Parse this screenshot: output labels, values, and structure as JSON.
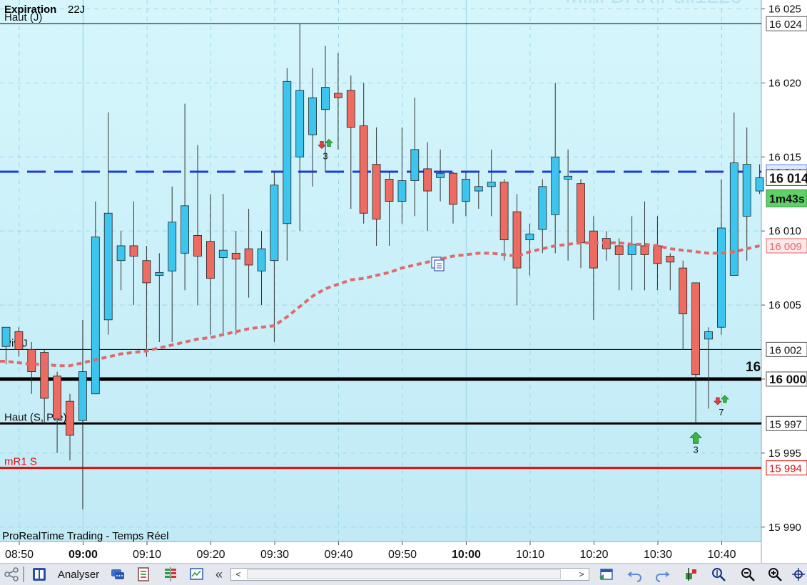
{
  "header": {
    "expiration_label": "Expiration",
    "expiration_value": "22J",
    "watermark": "Mini DAX Full1225",
    "branding": "ProRealTime Trading - Temps Réel"
  },
  "chart_data": {
    "type": "candlestick",
    "instrument": "Mini DAX Full1225",
    "ylim": [
      15989,
      16025.6
    ],
    "y_ticks": [
      {
        "value": 16025,
        "label": "16 025"
      },
      {
        "value": 16020,
        "label": "16 020"
      },
      {
        "value": 16015,
        "label": "16 015"
      },
      {
        "value": 16010,
        "label": "16 010"
      },
      {
        "value": 16005,
        "label": "16 005"
      },
      {
        "value": 16000,
        "label": "16 000"
      },
      {
        "value": 15995,
        "label": "15 995"
      },
      {
        "value": 15990,
        "label": "15 990"
      }
    ],
    "x_ticks": [
      {
        "label": "08:50",
        "major": false
      },
      {
        "label": "09:00",
        "major": true
      },
      {
        "label": "09:10",
        "major": false
      },
      {
        "label": "09:20",
        "major": false
      },
      {
        "label": "09:30",
        "major": false
      },
      {
        "label": "09:40",
        "major": false
      },
      {
        "label": "09:50",
        "major": false
      },
      {
        "label": "10:00",
        "major": true
      },
      {
        "label": "10:10",
        "major": false
      },
      {
        "label": "10:20",
        "major": false
      },
      {
        "label": "10:30",
        "major": false
      },
      {
        "label": "10:40",
        "major": false
      }
    ],
    "candles": [
      {
        "o": 16002.2,
        "h": 16003.0,
        "l": 16001.0,
        "c": 16003.5
      },
      {
        "o": 16003.2,
        "h": 16003.5,
        "l": 16001.5,
        "c": 16002.0
      },
      {
        "o": 16002.0,
        "h": 16002.5,
        "l": 15999.0,
        "c": 16000.5
      },
      {
        "o": 16001.8,
        "h": 16002.0,
        "l": 15997.0,
        "c": 15998.7
      },
      {
        "o": 16000.2,
        "h": 16000.5,
        "l": 15995.0,
        "c": 15997.3
      },
      {
        "o": 15998.5,
        "h": 15999.0,
        "l": 15994.5,
        "c": 15996.2
      },
      {
        "o": 15997.2,
        "h": 16004.0,
        "l": 15991.2,
        "c": 16000.5
      },
      {
        "o": 15999.0,
        "h": 16012.0,
        "l": 15999.0,
        "c": 16009.6
      },
      {
        "o": 16004.0,
        "h": 16018.0,
        "l": 16003.0,
        "c": 16011.2
      },
      {
        "o": 16008.0,
        "h": 16010.0,
        "l": 16006.0,
        "c": 16009.0
      },
      {
        "o": 16009.0,
        "h": 16012.0,
        "l": 16005.0,
        "c": 16008.3
      },
      {
        "o": 16008.0,
        "h": 16009.0,
        "l": 16001.5,
        "c": 16006.5
      },
      {
        "o": 16007.0,
        "h": 16008.5,
        "l": 16002.5,
        "c": 16007.2
      },
      {
        "o": 16007.3,
        "h": 16013.0,
        "l": 16002.5,
        "c": 16010.6
      },
      {
        "o": 16008.5,
        "h": 16018.6,
        "l": 16006.0,
        "c": 16011.7
      },
      {
        "o": 16009.7,
        "h": 16015.8,
        "l": 16005.0,
        "c": 16008.3
      },
      {
        "o": 16009.3,
        "h": 16012.5,
        "l": 16003.0,
        "c": 16006.8
      },
      {
        "o": 16008.2,
        "h": 16012.5,
        "l": 16003.0,
        "c": 16008.7
      },
      {
        "o": 16008.5,
        "h": 16010.0,
        "l": 16003.0,
        "c": 16008.1
      },
      {
        "o": 16008.8,
        "h": 16011.5,
        "l": 16005.5,
        "c": 16007.7
      },
      {
        "o": 16007.3,
        "h": 16010.0,
        "l": 16005.0,
        "c": 16008.8
      },
      {
        "o": 16008.0,
        "h": 16014.0,
        "l": 16002.5,
        "c": 16013.1
      },
      {
        "o": 16010.5,
        "h": 16021.0,
        "l": 16008.0,
        "c": 16020.1
      },
      {
        "o": 16015.0,
        "h": 16024.0,
        "l": 16010.0,
        "c": 16019.5
      },
      {
        "o": 16016.5,
        "h": 16021.0,
        "l": 16013.0,
        "c": 16019.0
      },
      {
        "o": 16018.2,
        "h": 16022.5,
        "l": 16014.0,
        "c": 16019.7
      },
      {
        "o": 16019.3,
        "h": 16022.0,
        "l": 16015.5,
        "c": 16019.0
      },
      {
        "o": 16019.5,
        "h": 16020.5,
        "l": 16011.5,
        "c": 16017.0
      },
      {
        "o": 16017.1,
        "h": 16020.0,
        "l": 16010.5,
        "c": 16011.2
      },
      {
        "o": 16014.5,
        "h": 16017.0,
        "l": 16009.0,
        "c": 16010.8
      },
      {
        "o": 16013.5,
        "h": 16014.0,
        "l": 16009.0,
        "c": 16012.0
      },
      {
        "o": 16012.0,
        "h": 16017.0,
        "l": 16010.5,
        "c": 16013.4
      },
      {
        "o": 16013.4,
        "h": 16019.0,
        "l": 16011.0,
        "c": 16015.5
      },
      {
        "o": 16014.2,
        "h": 16016.0,
        "l": 16010.0,
        "c": 16012.7
      },
      {
        "o": 16013.6,
        "h": 16015.5,
        "l": 16012.0,
        "c": 16013.9
      },
      {
        "o": 16013.9,
        "h": 16014.0,
        "l": 16010.5,
        "c": 16011.8
      },
      {
        "o": 16012.0,
        "h": 16014.0,
        "l": 16011.0,
        "c": 16013.5
      },
      {
        "o": 16012.7,
        "h": 16014.0,
        "l": 16011.5,
        "c": 16013.0
      },
      {
        "o": 16013.0,
        "h": 16015.5,
        "l": 16011.0,
        "c": 16013.3
      },
      {
        "o": 16013.3,
        "h": 16013.5,
        "l": 16008.0,
        "c": 16009.4
      },
      {
        "o": 16011.3,
        "h": 16012.5,
        "l": 16005.0,
        "c": 16007.5
      },
      {
        "o": 16009.4,
        "h": 16010.5,
        "l": 16007.0,
        "c": 16009.8
      },
      {
        "o": 16010.1,
        "h": 16013.5,
        "l": 16008.5,
        "c": 16013.0
      },
      {
        "o": 16011.1,
        "h": 16020.0,
        "l": 16008.5,
        "c": 16015.0
      },
      {
        "o": 16013.5,
        "h": 16015.5,
        "l": 16008.0,
        "c": 16013.7
      },
      {
        "o": 16013.2,
        "h": 16013.5,
        "l": 16007.5,
        "c": 16009.2
      },
      {
        "o": 16010.0,
        "h": 16011.0,
        "l": 16004.0,
        "c": 16007.5
      },
      {
        "o": 16009.5,
        "h": 16010.0,
        "l": 16008.0,
        "c": 16008.8
      },
      {
        "o": 16009.0,
        "h": 16009.5,
        "l": 16006.0,
        "c": 16008.4
      },
      {
        "o": 16008.4,
        "h": 16011.0,
        "l": 16006.0,
        "c": 16009.1
      },
      {
        "o": 16009.0,
        "h": 16012.0,
        "l": 16006.0,
        "c": 16008.4
      },
      {
        "o": 16009.0,
        "h": 16011.0,
        "l": 16006.0,
        "c": 16007.8
      },
      {
        "o": 16008.3,
        "h": 16008.5,
        "l": 16006.0,
        "c": 16007.9
      },
      {
        "o": 16007.5,
        "h": 16008.0,
        "l": 16002.0,
        "c": 16004.4
      },
      {
        "o": 16006.5,
        "h": 16006.5,
        "l": 15997.0,
        "c": 16000.3
      },
      {
        "o": 16002.7,
        "h": 16003.5,
        "l": 15998.0,
        "c": 16003.2
      },
      {
        "o": 16003.5,
        "h": 16013.5,
        "l": 16003.0,
        "c": 16010.2
      },
      {
        "o": 16007.0,
        "h": 16018.0,
        "l": 16007.0,
        "c": 16014.6
      },
      {
        "o": 16011.0,
        "h": 16017.0,
        "l": 16008.0,
        "c": 16014.5
      },
      {
        "o": 16012.7,
        "h": 16014.5,
        "l": 16012.5,
        "c": 16013.6
      }
    ],
    "moving_average": [
      16001.2,
      16001.1,
      16001.0,
      16001.0,
      16000.9,
      16000.9,
      16001.1,
      16001.3,
      16001.5,
      16001.7,
      16001.8,
      16001.9,
      16002.1,
      16002.3,
      16002.5,
      16002.7,
      16002.8,
      16003.0,
      16003.2,
      16003.4,
      16003.5,
      16003.6,
      16004.2,
      16004.9,
      16005.6,
      16006.1,
      16006.4,
      16006.7,
      16006.8,
      16007.0,
      16007.2,
      16007.5,
      16007.7,
      16007.9,
      16008.1,
      16008.3,
      16008.4,
      16008.5,
      16008.5,
      16008.4,
      16008.3,
      16008.6,
      16008.8,
      16009.0,
      16009.1,
      16009.2,
      16009.2,
      16009.2,
      16009.2,
      16009.1,
      16009.1,
      16009.0,
      16008.8,
      16008.7,
      16008.6,
      16008.5,
      16008.5,
      16008.6,
      16008.8,
      16009.0
    ],
    "horizontal_lines": [
      {
        "name": "Haut (J)",
        "value": 16024,
        "price_label": "16 024",
        "color": "#000000",
        "style": "solid",
        "weight": "thin"
      },
      {
        "name": "Piv J",
        "value": 16002,
        "price_label": "16 002",
        "color": "#000000",
        "style": "solid",
        "weight": "thin"
      },
      {
        "name": "",
        "value": 16000,
        "price_label": "16 000",
        "color": "#000000",
        "style": "solid",
        "weight": "thick"
      },
      {
        "name": "Haut (S, Pré)",
        "value": 15997,
        "price_label": "15 997",
        "color": "#000000",
        "style": "solid",
        "weight": "medium"
      },
      {
        "name": "mR1 S",
        "value": 15994,
        "price_label": "15 994",
        "color": "#e01010",
        "style": "solid",
        "weight": "medium"
      },
      {
        "name": "",
        "value": 16014,
        "price_label": "16 014",
        "color": "#1a3ed8",
        "style": "dashed",
        "weight": "medium"
      }
    ],
    "current_price": {
      "value": 16013.6,
      "label": "16 014",
      "countdown": "1m43s"
    },
    "ma_last_label": "16 009",
    "partial_level_label": "16",
    "annotations": [
      {
        "candle": 25,
        "value": 16016.0,
        "text": "3",
        "icon": "up-down-arrows-icon"
      },
      {
        "candle": 54,
        "value": 15997.0,
        "text": "3",
        "icon": "up-arrow-icon"
      },
      {
        "candle": 56,
        "value": 15998.7,
        "text": "7",
        "icon": "up-down-arrows-icon"
      }
    ],
    "colors": {
      "up": "#3cc6ef",
      "down": "#ee6b62",
      "ma": "#dd6b6b",
      "bg_top": "#d2f4fb",
      "bg_bottom": "#c3ebf7",
      "grid": "#9bd8e6"
    }
  },
  "toolbar": {
    "analyser_label": "Analyser",
    "scroll_left": "<",
    "scroll_right": ">",
    "collapse": "«"
  }
}
